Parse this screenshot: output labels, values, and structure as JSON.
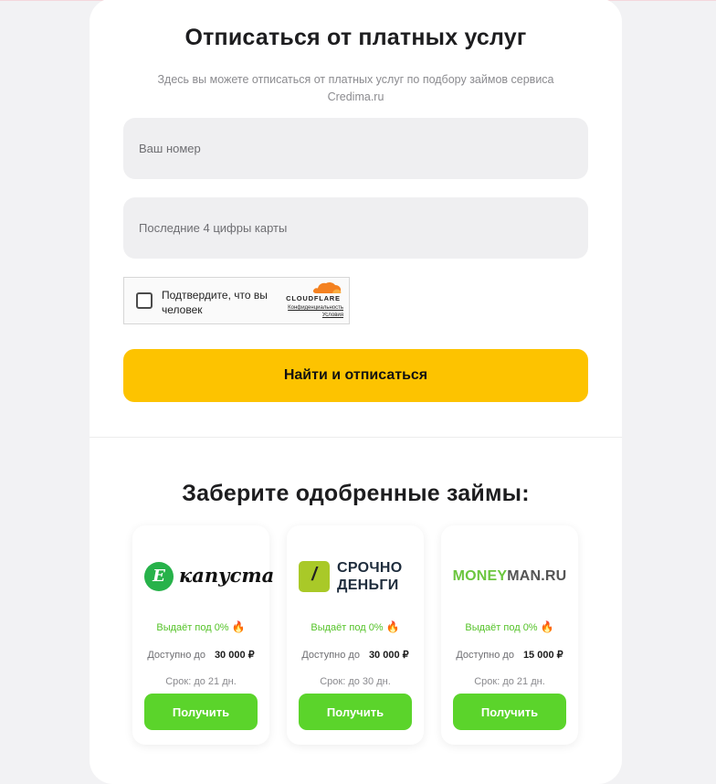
{
  "unsubscribe": {
    "title": "Отписаться от платных услуг",
    "subtitle": "Здесь вы можете отписаться от платных услуг по подбору займов сервиса Credima.ru",
    "phone_placeholder": "Ваш номер",
    "card_placeholder": "Последние 4 цифры карты",
    "submit_label": "Найти и отписаться"
  },
  "captcha": {
    "label": "Подтвердите, что вы человек",
    "brand": "CLOUDFLARE",
    "privacy_link": "Конфиденциальность",
    "terms_link": "Условия"
  },
  "offers_section": {
    "title": "Заберите одобренные займы:",
    "offers": [
      {
        "brand": "капуста",
        "logo_letter": "Е",
        "promo": "Выдаёт под 0%",
        "amount_label": "Доступно до",
        "amount": "30 000 ₽",
        "term": "Срок: до 21 дн.",
        "button": "Получить"
      },
      {
        "brand_line1": "СРОЧНО",
        "brand_line2": "ДЕНЬГИ",
        "promo": "Выдаёт под 0%",
        "amount_label": "Доступно до",
        "amount": "30 000 ₽",
        "term": "Срок: до 30 дн.",
        "button": "Получить"
      },
      {
        "brand_part1": "MONEY",
        "brand_part2": "MAN.RU",
        "promo": "Выдаёт под 0%",
        "amount_label": "Доступно до",
        "amount": "15 000 ₽",
        "term": "Срок: до 21 дн.",
        "button": "Получить"
      }
    ]
  },
  "colors": {
    "accent_yellow": "#fdc300",
    "cta_green": "#5bd42b",
    "promo_green": "#56c32a",
    "field_bg": "#efeff1"
  },
  "icons": [
    "fire-icon",
    "cloudflare-cloud-icon",
    "checkbox"
  ]
}
